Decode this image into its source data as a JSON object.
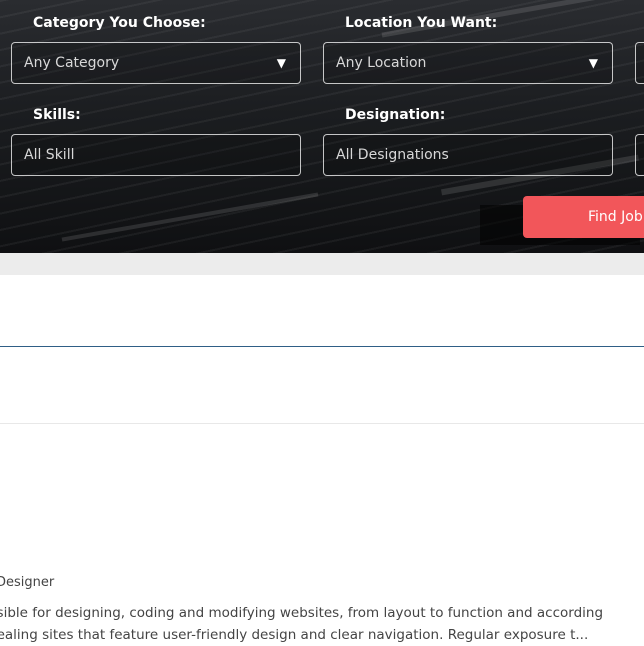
{
  "search": {
    "category_label": "Category You Choose:",
    "category_value": "Any Category",
    "location_label": "Location You Want:",
    "location_value": "Any Location",
    "skills_label": "Skills:",
    "skills_placeholder": "All Skill",
    "designation_label": "Designation:",
    "designation_placeholder": "All Designations",
    "find_button": "Find Job"
  },
  "job": {
    "title": "Designer",
    "description_line1": "nsible for designing, coding and modifying websites, from layout to function and according",
    "description_line2": "pealing sites that feature user-friendly design and clear navigation. Regular exposure t..."
  },
  "colors": {
    "accent_button": "#f2565a",
    "divider_blue": "#2f5e86"
  }
}
